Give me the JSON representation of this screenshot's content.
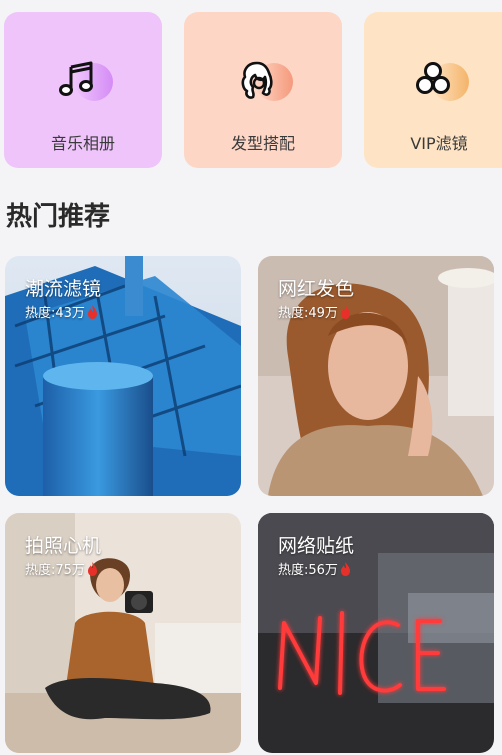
{
  "categories": [
    {
      "label": "音乐相册",
      "icon": "music-note-icon",
      "bg": "#eec4fb",
      "accent": "#d58cf6"
    },
    {
      "label": "发型搭配",
      "icon": "hair-style-icon",
      "bg": "#fdd6c6",
      "accent": "#f59a7c"
    },
    {
      "label": "VIP滤镜",
      "icon": "filter-circles-icon",
      "bg": "#fee4c4",
      "accent": "#f4b46a"
    }
  ],
  "section": {
    "title": "热门推荐"
  },
  "tiles": [
    {
      "title": "潮流滤镜",
      "heat": "热度:43万"
    },
    {
      "title": "网红发色",
      "heat": "热度:49万"
    },
    {
      "title": "拍照心机",
      "heat": "热度:75万"
    },
    {
      "title": "网络贴纸",
      "heat": "热度:56万"
    }
  ],
  "colors": {
    "flame": "#e8302a",
    "neon": "#ff3a3a"
  }
}
